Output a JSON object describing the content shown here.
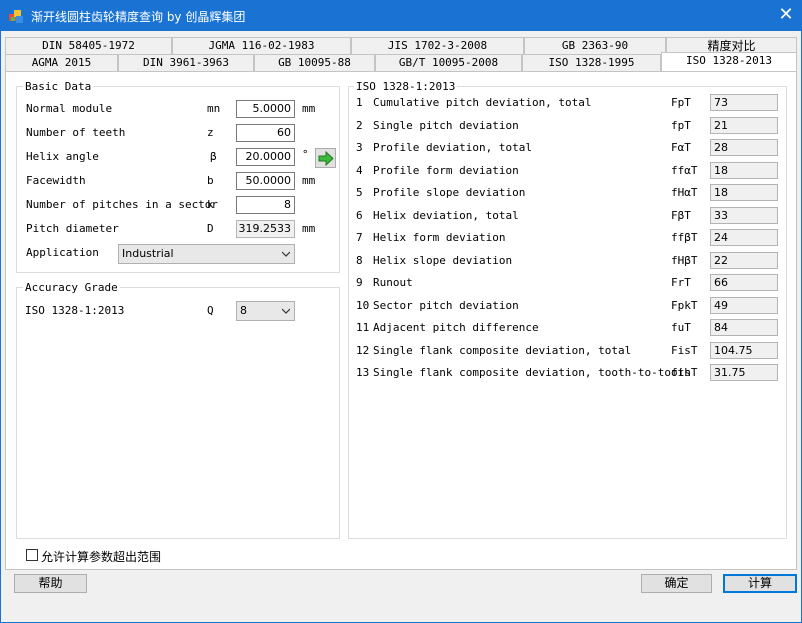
{
  "window": {
    "title": "渐开线圆柱齿轮精度查询 by 创晶辉集团",
    "close_glyph": "✕",
    "app_icon": "app-icon"
  },
  "tabs": {
    "row1": [
      "DIN 58405-1972",
      "JGMA 116-02-1983",
      "JIS 1702-3-2008",
      "GB 2363-90",
      "精度对比"
    ],
    "row2": [
      "AGMA 2015",
      "DIN 3961-3963",
      "GB 10095-88",
      "GB/T 10095-2008",
      "ISO 1328-1995",
      "ISO 1328-2013"
    ],
    "active": "ISO 1328-2013"
  },
  "basic_data": {
    "title": "Basic Data",
    "rows": [
      {
        "label": "Normal module",
        "symbol": "mn",
        "value": "5.0000",
        "unit": "mm"
      },
      {
        "label": "Number of teeth",
        "symbol": "z",
        "value": "60",
        "unit": ""
      },
      {
        "label": "Helix angle",
        "symbol": "β",
        "value": "20.0000",
        "unit": "°"
      },
      {
        "label": "Facewidth",
        "symbol": "b",
        "value": "50.0000",
        "unit": "mm"
      },
      {
        "label": "Number of pitches in a sector",
        "symbol": "k",
        "value": "8",
        "unit": ""
      },
      {
        "label": "Pitch diameter",
        "symbol": "D",
        "value": "319.2533",
        "unit": "mm"
      }
    ],
    "application_label": "Application",
    "application_value": "Industrial",
    "arrow_icon": "green-arrow-right-icon"
  },
  "accuracy_grade": {
    "title": "Accuracy Grade",
    "standard": "ISO 1328-1:2013",
    "symbol": "Q",
    "value": "8"
  },
  "results": {
    "title": "ISO 1328-1:2013",
    "rows": [
      {
        "n": "1",
        "label": "Cumulative pitch deviation, total",
        "symbol": "FpT",
        "value": "73"
      },
      {
        "n": "2",
        "label": "Single pitch deviation",
        "symbol": "fpT",
        "value": "21"
      },
      {
        "n": "3",
        "label": "Profile deviation, total",
        "symbol": "FαT",
        "value": "28"
      },
      {
        "n": "4",
        "label": "Profile form deviation",
        "symbol": "ffαT",
        "value": "18"
      },
      {
        "n": "5",
        "label": "Profile slope deviation",
        "symbol": "fHαT",
        "value": "18"
      },
      {
        "n": "6",
        "label": "Helix deviation, total",
        "symbol": "FβT",
        "value": "33"
      },
      {
        "n": "7",
        "label": "Helix form deviation",
        "symbol": "ffβT",
        "value": "24"
      },
      {
        "n": "8",
        "label": "Helix slope deviation",
        "symbol": "fHβT",
        "value": "22"
      },
      {
        "n": "9",
        "label": "Runout",
        "symbol": "FrT",
        "value": "66"
      },
      {
        "n": "10",
        "label": "Sector pitch deviation",
        "symbol": "FpkT",
        "value": "49"
      },
      {
        "n": "11",
        "label": "Adjacent pitch difference",
        "symbol": "fuT",
        "value": "84"
      },
      {
        "n": "12",
        "label": "Single flank composite deviation, total",
        "symbol": "FisT",
        "value": "104.75"
      },
      {
        "n": "13",
        "label": "Single flank composite deviation, tooth-to-tooth",
        "symbol": "fisT",
        "value": "31.75"
      }
    ]
  },
  "footer": {
    "allow_label": "允许计算参数超出范围",
    "allow_checked": false,
    "help_label": "帮助",
    "ok_label": "确定",
    "calc_label": "计算"
  }
}
